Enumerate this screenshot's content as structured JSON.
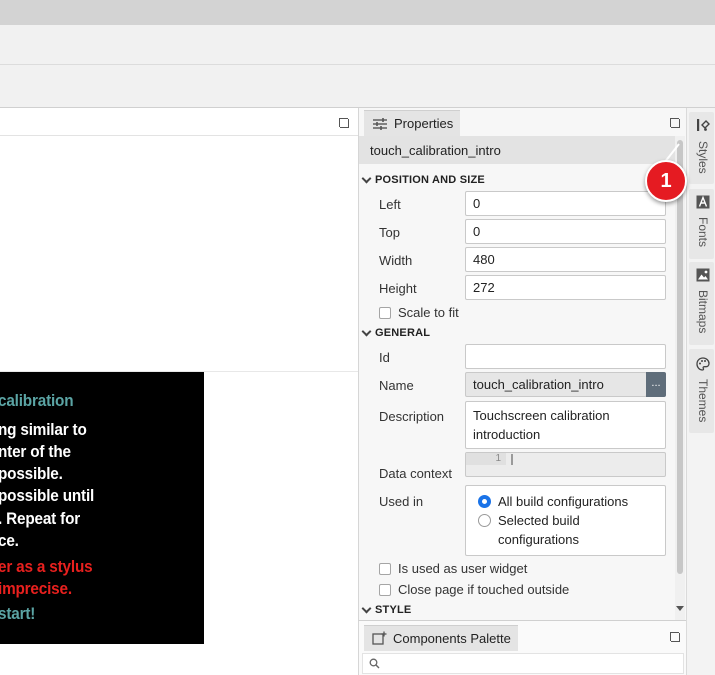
{
  "properties": {
    "tab_label": "Properties",
    "object_name": "touch_calibration_intro",
    "position_and_size": {
      "header": "POSITION AND SIZE",
      "left_label": "Left",
      "left_value": "0",
      "top_label": "Top",
      "top_value": "0",
      "width_label": "Width",
      "width_value": "480",
      "height_label": "Height",
      "height_value": "272",
      "scale_to_fit_label": "Scale to fit"
    },
    "general": {
      "header": "GENERAL",
      "id_label": "Id",
      "id_value": "",
      "name_label": "Name",
      "name_value": "touch_calibration_intro",
      "name_button": "...",
      "description_label": "Description",
      "description_line1": "Touchscreen calibration",
      "description_line2": "introduction",
      "data_context_label": "Data context",
      "data_context_line_number": "1",
      "used_in_label": "Used in",
      "used_in_option1": "All build configurations",
      "used_in_option2_line1": "Selected build",
      "used_in_option2_line2": "configurations",
      "used_in_selected": "All build configurations",
      "user_widget_label": "Is used as user widget",
      "close_outside_label": "Close page if touched outside"
    },
    "style": {
      "header": "STYLE"
    }
  },
  "palette": {
    "tab_label": "Components Palette",
    "search_placeholder": ""
  },
  "side_rail": {
    "styles": "Styles",
    "fonts": "Fonts",
    "bitmaps": "Bitmaps",
    "themes": "Themes"
  },
  "annotation": {
    "badge_number": "1"
  },
  "preview": {
    "line1": "calibration",
    "line2": "ng similar to",
    "line3": "nter of the",
    "line4": "possible.",
    "line5": "possible until",
    "line6": ". Repeat for",
    "line7": "ce.",
    "line8": "er as a stylus",
    "line9": "imprecise.",
    "line10": "start!"
  },
  "colors": {
    "accent": "#1a73e8",
    "badge": "#e51b22",
    "preview_teal": "#5ba4a4",
    "preview_red": "#e8201e"
  }
}
